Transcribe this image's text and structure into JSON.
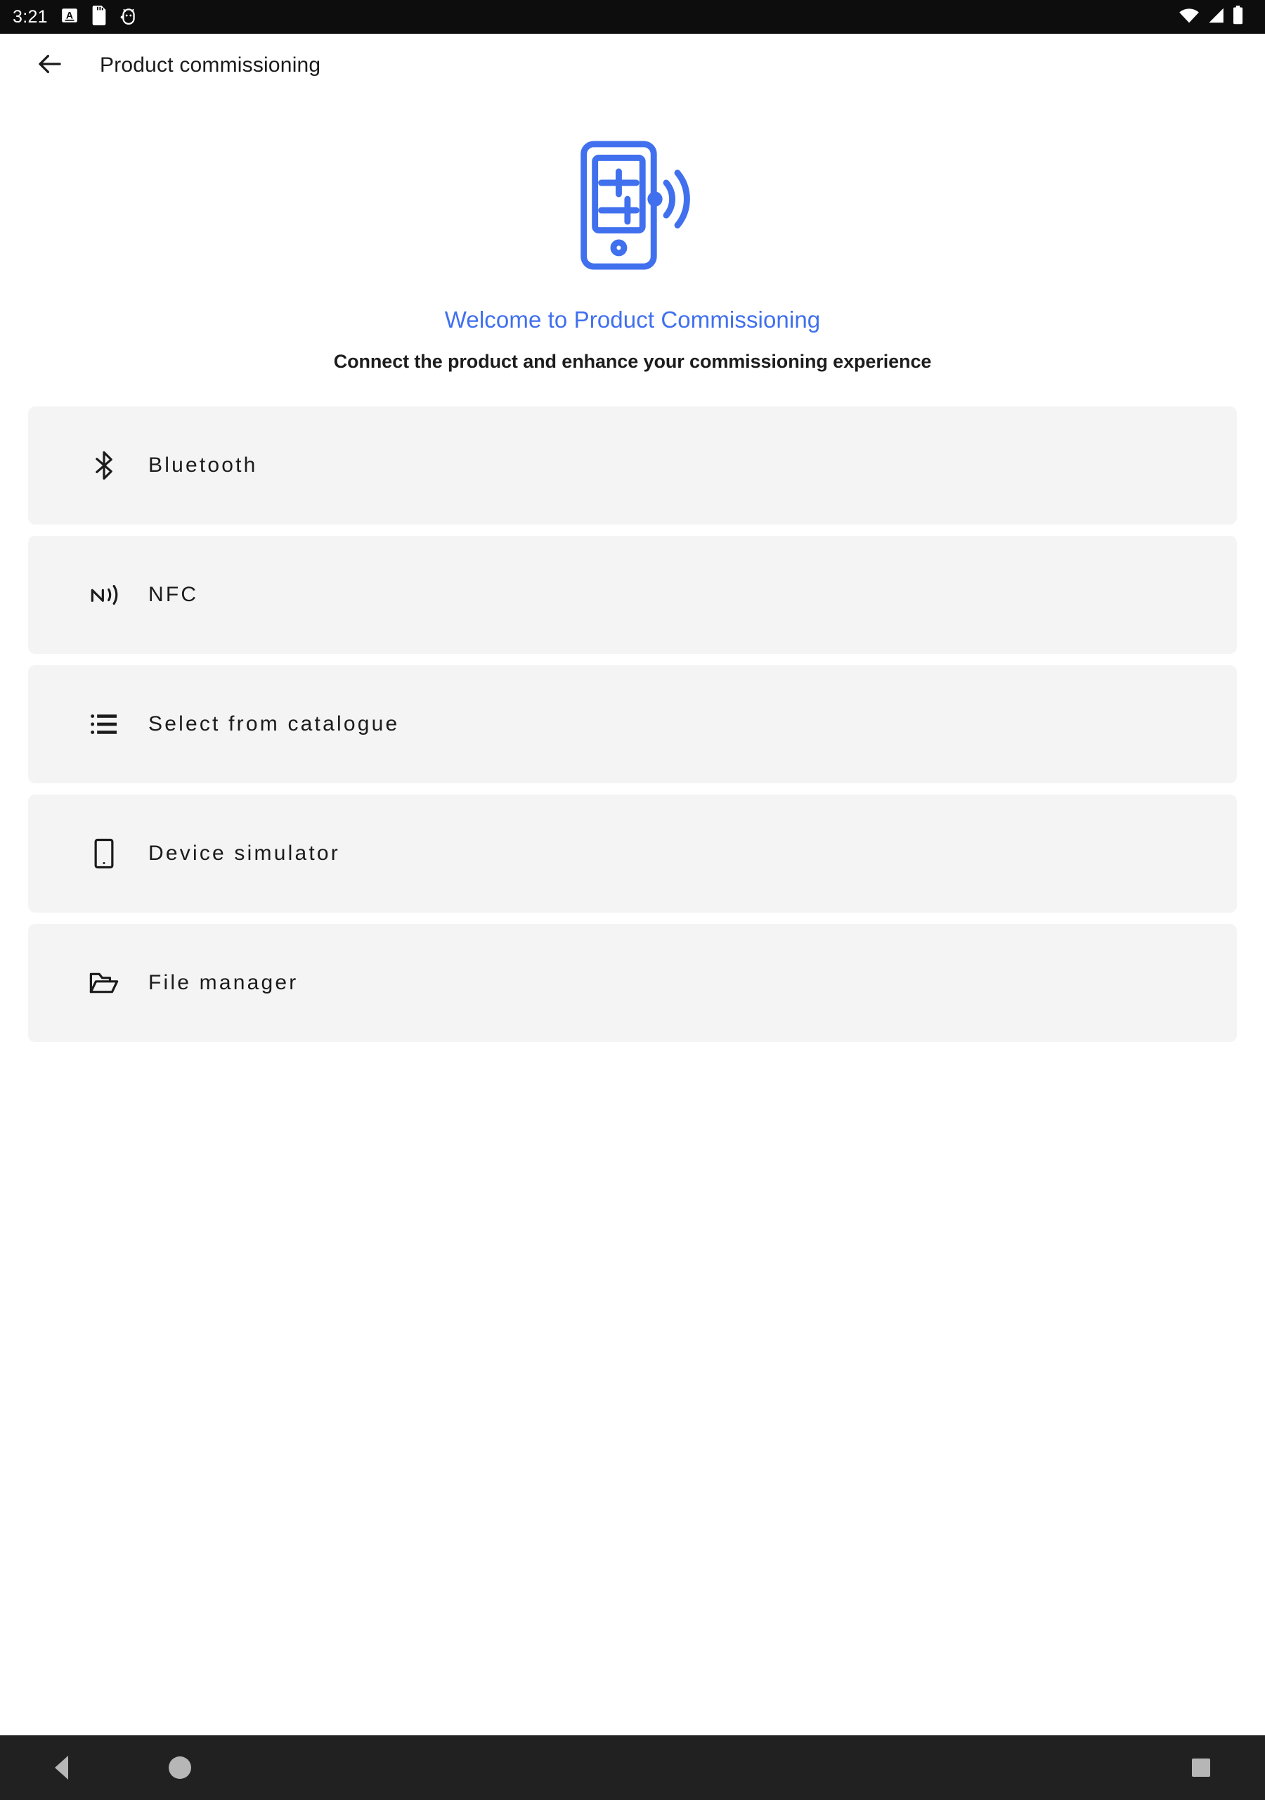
{
  "status_bar": {
    "time": "3:21",
    "left_icons": [
      "text-input-indicator-icon",
      "sd-card-icon",
      "android-debug-icon"
    ],
    "right_icons": [
      "wifi-icon",
      "cellular-signal-icon",
      "battery-icon"
    ],
    "background_color": "#0d0d0d",
    "foreground_color": "#ffffff"
  },
  "app_bar": {
    "back_icon": "arrow-left-icon",
    "title": "Product commissioning"
  },
  "hero": {
    "illustration": "phone-with-settings-sliders-and-wireless-waves-icon",
    "illustration_color": "#4070ee",
    "title": "Welcome to Product Commissioning",
    "title_color": "#4070ee",
    "subtitle": "Connect the product and enhance your commissioning experience",
    "subtitle_color": "#1d1d1d"
  },
  "options": {
    "card_background": "#f4f4f4",
    "items": [
      {
        "label": "Bluetooth",
        "icon": "bluetooth-icon"
      },
      {
        "label": "NFC",
        "icon": "nfc-icon"
      },
      {
        "label": "Select from catalogue",
        "icon": "list-icon"
      },
      {
        "label": "Device simulator",
        "icon": "smartphone-icon"
      },
      {
        "label": "File manager",
        "icon": "folder-open-icon"
      }
    ]
  },
  "navigation_bar": {
    "background_color": "#212121",
    "buttons": [
      {
        "name": "back",
        "icon": "triangle-back-icon"
      },
      {
        "name": "home",
        "icon": "circle-home-icon"
      },
      {
        "name": "recents",
        "icon": "square-recents-icon"
      }
    ]
  }
}
